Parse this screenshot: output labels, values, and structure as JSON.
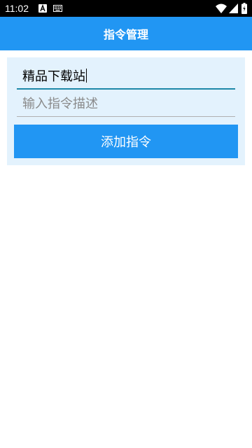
{
  "status_bar": {
    "time": "11:02",
    "left_icons": [
      "font-a-icon",
      "keyboard-icon"
    ],
    "right_icons": [
      "wifi-icon",
      "signal-icon",
      "battery-icon"
    ]
  },
  "app_bar": {
    "title": "指令管理"
  },
  "form": {
    "command_input": {
      "value": "精品下载站"
    },
    "description_input": {
      "value": "",
      "placeholder": "输入指令描述"
    },
    "add_button_label": "添加指令"
  },
  "colors": {
    "primary": "#2196F3",
    "card_background": "#E3F2FD",
    "focused_underline": "#1E88A8",
    "unfocused_underline": "#B0B0B0"
  }
}
